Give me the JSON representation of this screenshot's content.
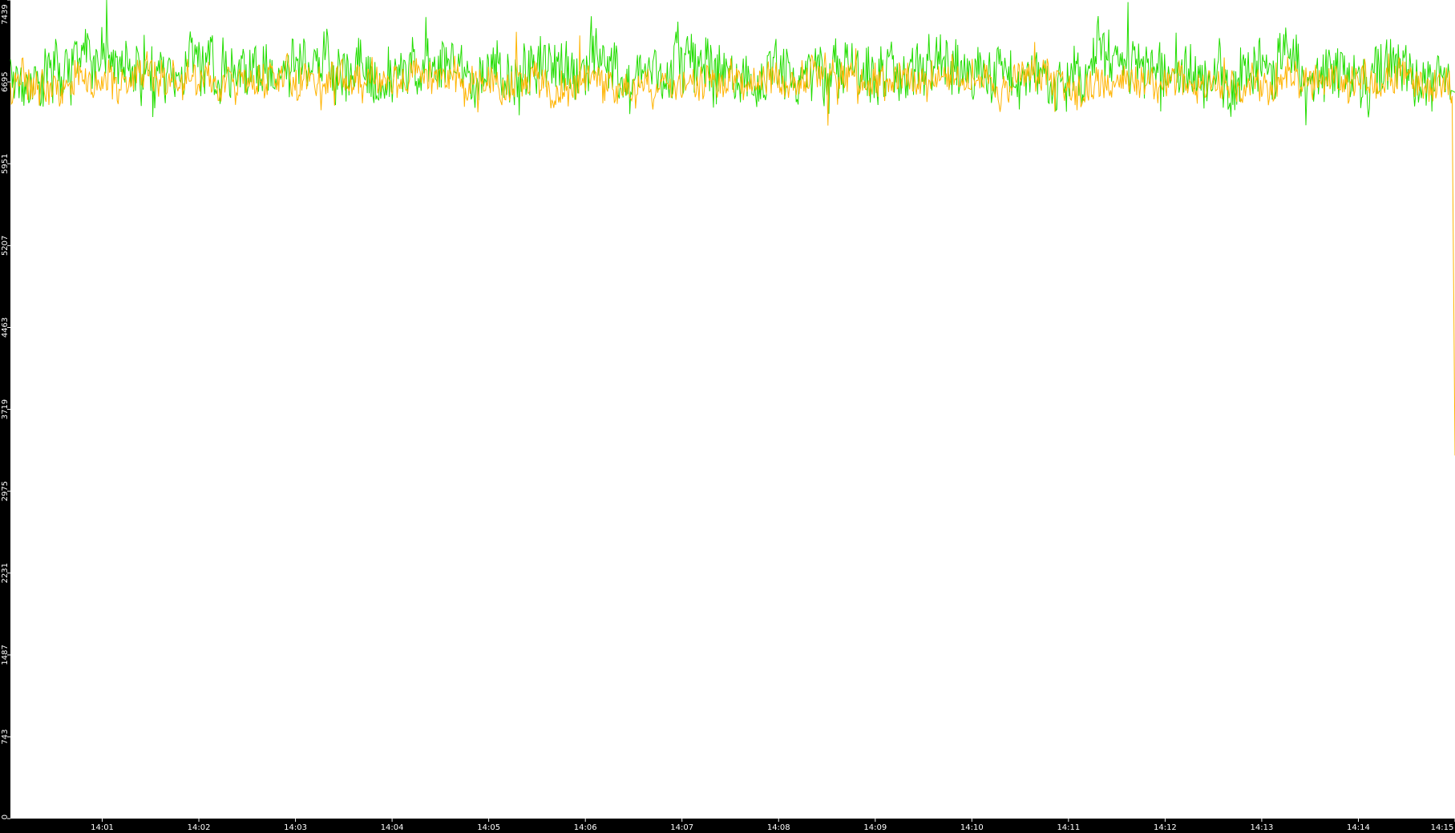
{
  "chart_data": {
    "type": "line",
    "title": "",
    "xlabel": "",
    "ylabel": "",
    "background": "#ffffff",
    "frame_color": "#000000",
    "label_color": "#ffffff",
    "grid": false,
    "ylim": [
      0,
      7439
    ],
    "yticks": [
      0,
      743,
      1487,
      2231,
      2975,
      3719,
      4463,
      5207,
      5951,
      6695,
      7439
    ],
    "ytick_labels": [
      "0",
      "743",
      "1487",
      "2231",
      "2975",
      "3719",
      "4463",
      "5207",
      "5951",
      "6695",
      "7439"
    ],
    "xlim_minutes": [
      840.05,
      855.0
    ],
    "xticks_minutes": [
      841,
      842,
      843,
      844,
      845,
      846,
      847,
      848,
      849,
      850,
      851,
      852,
      853,
      854,
      855
    ],
    "xtick_labels": [
      "14:01",
      "14:02",
      "14:03",
      "14:04",
      "14:05",
      "14:06",
      "14:07",
      "14:08",
      "14:09",
      "14:10",
      "14:11",
      "14:12",
      "14:13",
      "14:14",
      "14:15"
    ],
    "series": [
      {
        "color": "#22dd00",
        "baseline": 6800,
        "spread": 280,
        "min": 6000,
        "max": 7439,
        "points": 1500,
        "seed": 17,
        "end_value": 6600
      },
      {
        "color": "#ffb400",
        "baseline": 6700,
        "spread": 180,
        "min": 5900,
        "max": 7150,
        "points": 1500,
        "seed": 91,
        "end_value": 3300
      }
    ]
  }
}
